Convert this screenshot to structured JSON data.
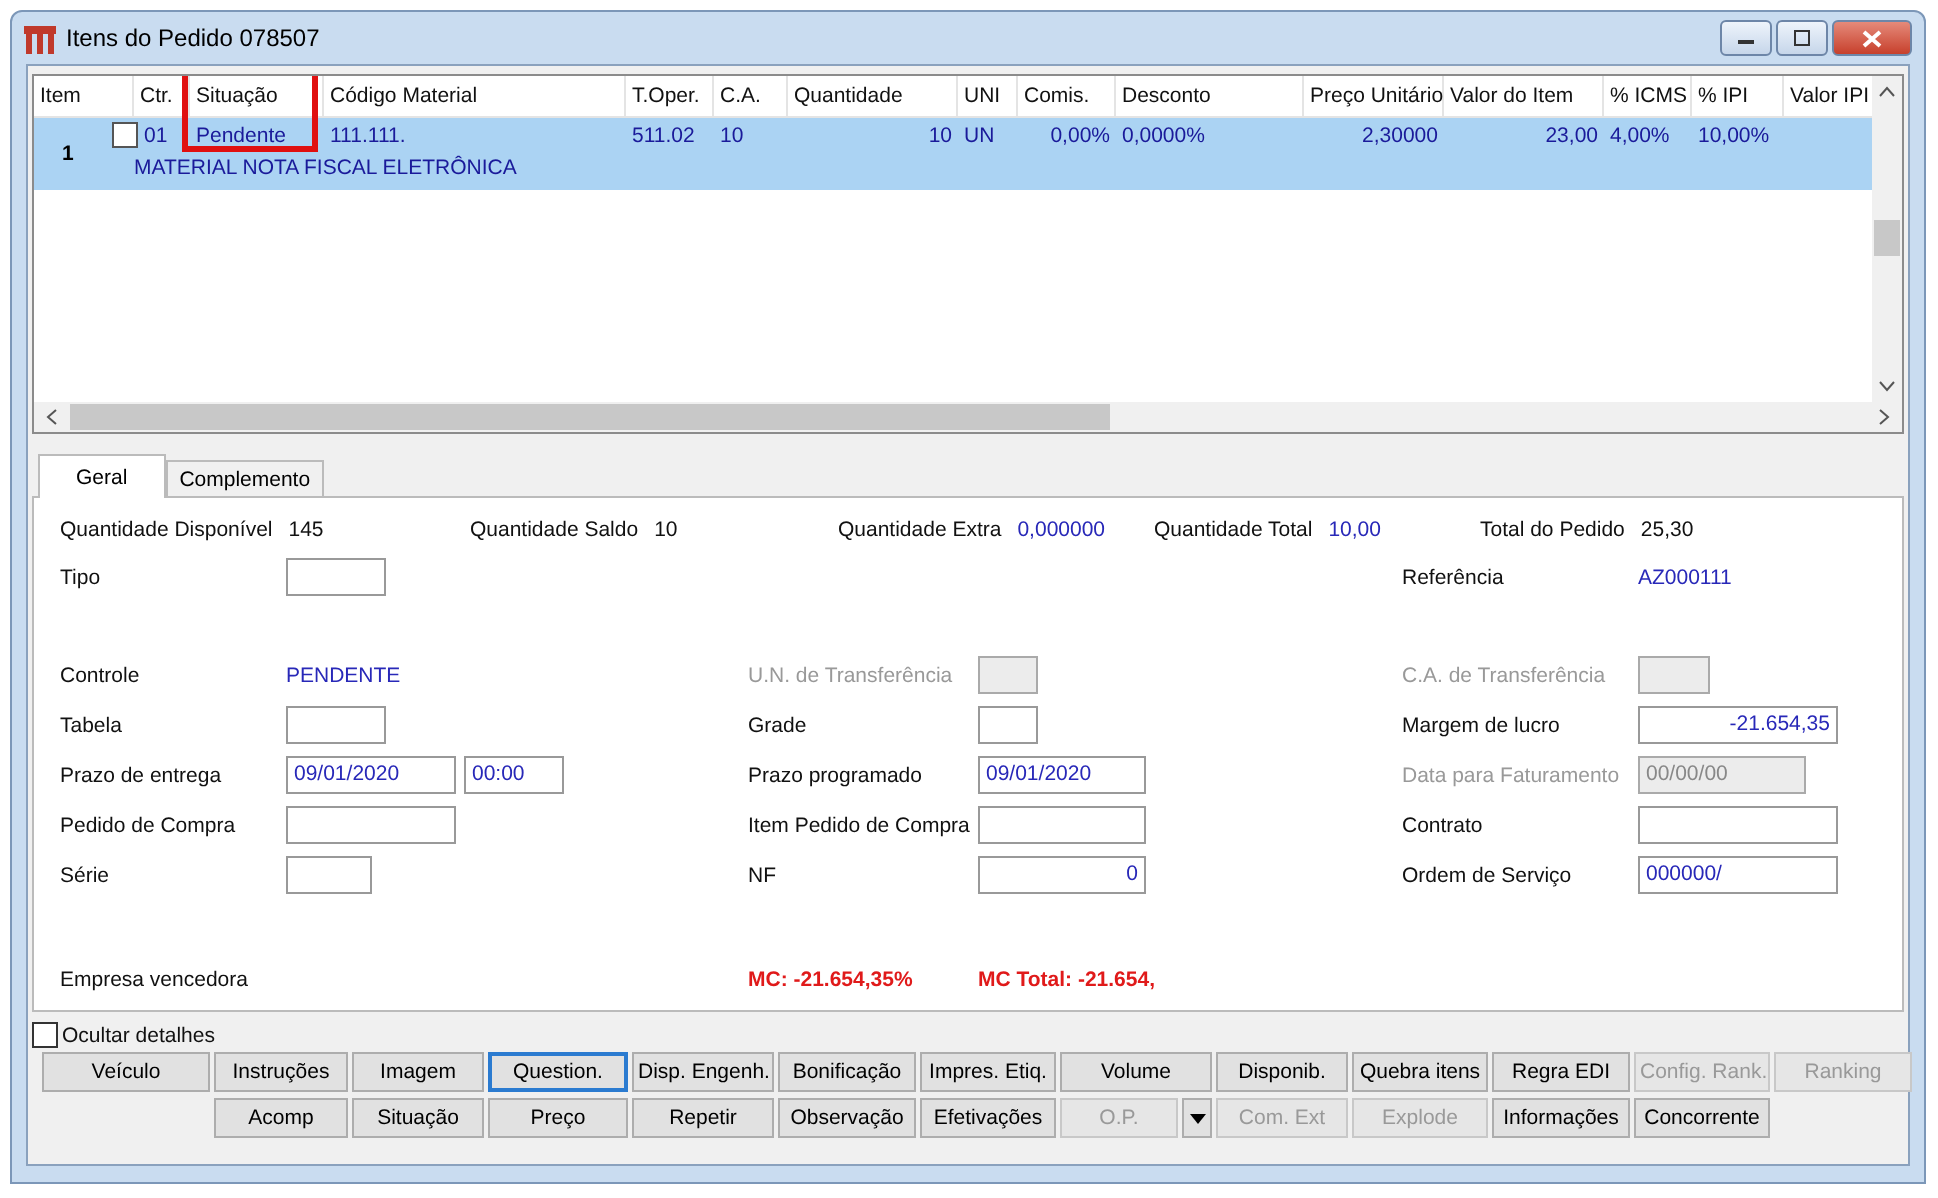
{
  "window": {
    "title": "Itens do Pedido 078507"
  },
  "grid": {
    "columns": [
      {
        "label": "Item",
        "highlighted": false
      },
      {
        "label": "Ctr.",
        "highlighted": false
      },
      {
        "label": "Situação",
        "highlighted": true
      },
      {
        "label": "Código Material",
        "highlighted": false
      },
      {
        "label": "T.Oper.",
        "highlighted": false
      },
      {
        "label": "C.A.",
        "highlighted": false
      },
      {
        "label": "Quantidade",
        "highlighted": false
      },
      {
        "label": "UNI",
        "highlighted": false
      },
      {
        "label": "Comis.",
        "highlighted": false
      },
      {
        "label": "Desconto",
        "highlighted": false
      },
      {
        "label": "Preço Unitário",
        "highlighted": false
      },
      {
        "label": "Valor do Item",
        "highlighted": false
      },
      {
        "label": "% ICMS",
        "highlighted": false
      },
      {
        "label": "% IPI",
        "highlighted": false
      },
      {
        "label": "Valor IPI",
        "highlighted": false
      }
    ],
    "rows": [
      {
        "selected": true,
        "item": "1",
        "checked": false,
        "ctr": "01",
        "situacao": "Pendente",
        "codigo": "111.111.",
        "toper": "511.02",
        "ca": "10",
        "quantidade": "10",
        "uni": "UN",
        "comis": "0,00%",
        "desconto": "0,0000%",
        "preco": "2,30000",
        "valor": "23,00",
        "icms": "4,00%",
        "ipi": "10,00%",
        "description": "MATERIAL NOTA FISCAL ELETRÔNICA"
      }
    ]
  },
  "tabs": [
    {
      "label": "Geral",
      "selected": true
    },
    {
      "label": "Complemento",
      "selected": false
    }
  ],
  "summary": [
    {
      "label": "Quantidade Disponível",
      "value": "145",
      "kind": "plain"
    },
    {
      "label": "Quantidade Saldo",
      "value": "10",
      "kind": "plain"
    },
    {
      "label": "Quantidade Extra",
      "value": "0,000000",
      "kind": "accent"
    },
    {
      "label": "Quantidade Total",
      "value": "10,00",
      "kind": "accent"
    },
    {
      "label": "Total do Pedido",
      "value": "25,30",
      "kind": "plain"
    }
  ],
  "form": [
    [
      {
        "kind": "field",
        "label": "Tipo",
        "disabled": false
      },
      {
        "kind": "none"
      },
      {
        "kind": "text",
        "label": "Referência",
        "value": "AZ000111"
      }
    ],
    [
      {
        "kind": "text",
        "label": "Controle",
        "value": "PENDENTE"
      },
      {
        "kind": "field",
        "label": "U.N. de Transferência",
        "disabled": true
      },
      {
        "kind": "field",
        "label": "C.A. de Transferência",
        "disabled": true
      }
    ],
    [
      {
        "kind": "field",
        "label": "Tabela",
        "disabled": false
      },
      {
        "kind": "field",
        "label": "Grade",
        "disabled": false
      },
      {
        "kind": "number",
        "label": "Margem de lucro",
        "value": "-21.654,35",
        "disabled": false
      }
    ],
    [
      {
        "kind": "pair",
        "label": "Prazo de entrega",
        "value": "09/01/2020",
        "value2": "00:00",
        "disabled": false
      },
      {
        "kind": "field",
        "label": "Prazo programado",
        "value": "09/01/2020",
        "disabled": false
      },
      {
        "kind": "field",
        "label": "Data para Faturamento",
        "value": "00/00/00",
        "disabled": true
      }
    ],
    [
      {
        "kind": "field",
        "label": "Pedido de Compra",
        "disabled": false
      },
      {
        "kind": "field",
        "label": "Item Pedido de Compra",
        "disabled": false
      },
      {
        "kind": "field",
        "label": "Contrato",
        "disabled": false
      }
    ],
    [
      {
        "kind": "field",
        "label": "Série",
        "disabled": false
      },
      {
        "kind": "number",
        "label": "NF",
        "value": "0",
        "disabled": false
      },
      {
        "kind": "field",
        "label": "Ordem de Serviço",
        "value": "000000/",
        "disabled": false
      }
    ]
  ],
  "footer": {
    "label": "Empresa vencedora",
    "mc": "MC: -21.654,35%",
    "mc_total": "MC Total: -21.654,"
  },
  "hide_details": {
    "label": "Ocultar detalhes",
    "checked": false
  },
  "buttons_row_1": [
    {
      "label": "Veículo",
      "disabled": false,
      "focused": false
    },
    {
      "label": "Instruções",
      "disabled": false,
      "focused": false
    },
    {
      "label": "Imagem",
      "disabled": false,
      "focused": false
    },
    {
      "label": "Question.",
      "disabled": false,
      "focused": true
    },
    {
      "label": "Disp. Engenh.",
      "disabled": false,
      "focused": false
    },
    {
      "label": "Bonificação",
      "disabled": false,
      "focused": false
    },
    {
      "label": "Impres. Etiq.",
      "disabled": false,
      "focused": false
    },
    {
      "label": "Volume",
      "disabled": false,
      "focused": false
    },
    {
      "label": "Disponib.",
      "disabled": false,
      "focused": false
    },
    {
      "label": "Quebra itens",
      "disabled": false,
      "focused": false
    },
    {
      "label": "Regra EDI",
      "disabled": false,
      "focused": false
    },
    {
      "label": "Config. Rank.",
      "disabled": true,
      "focused": false
    },
    {
      "label": "Ranking",
      "disabled": true,
      "focused": false
    }
  ],
  "buttons_row_2": [
    {
      "label": "Acomp",
      "disabled": false,
      "dropdown": false
    },
    {
      "label": "Situação",
      "disabled": false,
      "dropdown": false
    },
    {
      "label": "Preço",
      "disabled": false,
      "dropdown": false
    },
    {
      "label": "Repetir",
      "disabled": false,
      "dropdown": false
    },
    {
      "label": "Observação",
      "disabled": false,
      "dropdown": false
    },
    {
      "label": "Efetivações",
      "disabled": false,
      "dropdown": false
    },
    {
      "label": "O.P.",
      "disabled": true,
      "dropdown": true
    },
    {
      "label": "Com. Ext",
      "disabled": true,
      "dropdown": false
    },
    {
      "label": "Explode",
      "disabled": true,
      "dropdown": false
    },
    {
      "label": "Informações",
      "disabled": false,
      "dropdown": false
    },
    {
      "label": "Concorrente",
      "disabled": false,
      "dropdown": false
    }
  ]
}
